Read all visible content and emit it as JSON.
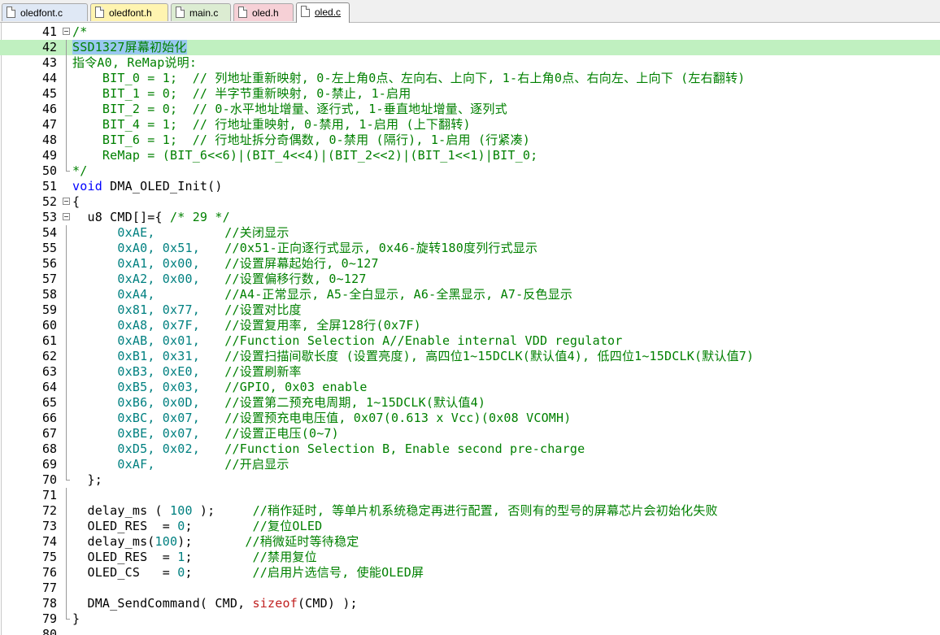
{
  "tabs": [
    {
      "label": "oledfont.c",
      "color": "#dfe8f5",
      "active": false
    },
    {
      "label": "oledfont.h",
      "color": "#fff4b0",
      "active": false
    },
    {
      "label": "main.c",
      "color": "#dcecd2",
      "active": false
    },
    {
      "label": "oled.h",
      "color": "#f6d0d6",
      "active": false
    },
    {
      "label": "oled.c",
      "color": "#ffffff",
      "active": true
    }
  ],
  "editor": {
    "lines": [
      {
        "num": "41",
        "text": "/*",
        "kind": "comment"
      },
      {
        "num": "42",
        "text": "SSD1327屏幕初始化",
        "kind": "comment-selected"
      },
      {
        "num": "43",
        "text": "指令A0, ReMap说明:",
        "kind": "comment"
      },
      {
        "num": "44",
        "text": "    BIT_0 = 1;  // 列地址重新映射, 0-左上角0点、左向右、上向下, 1-右上角0点、右向左、上向下 (左右翻转)",
        "kind": "comment"
      },
      {
        "num": "45",
        "text": "    BIT_1 = 0;  // 半字节重新映射, 0-禁止, 1-启用",
        "kind": "comment"
      },
      {
        "num": "46",
        "text": "    BIT_2 = 0;  // 0-水平地址增量、逐行式, 1-垂直地址增量、逐列式",
        "kind": "comment"
      },
      {
        "num": "47",
        "text": "    BIT_4 = 1;  // 行地址重映射, 0-禁用, 1-启用 (上下翻转)",
        "kind": "comment"
      },
      {
        "num": "48",
        "text": "    BIT_6 = 1;  // 行地址拆分奇偶数, 0-禁用 (隔行), 1-启用 (行紧凑)",
        "kind": "comment"
      },
      {
        "num": "49",
        "text": "    ReMap = (BIT_6<<6)|(BIT_4<<4)|(BIT_2<<2)|(BIT_1<<1)|BIT_0;",
        "kind": "comment"
      },
      {
        "num": "50",
        "text": "*/",
        "kind": "comment"
      },
      {
        "num": "51",
        "text_kw": "void",
        "text_rest": " DMA_OLED_Init()",
        "kind": "funcdecl"
      },
      {
        "num": "52",
        "text": "{",
        "kind": "plain"
      },
      {
        "num": "53",
        "text_plain": "  u8 CMD[]={ ",
        "text_comment": "/* 29 */",
        "kind": "arraydecl"
      },
      {
        "num": "54",
        "hex1": "0xAE,",
        "hex2": "",
        "comment": "//关闭显示",
        "kind": "cmd"
      },
      {
        "num": "55",
        "hex1": "0xA0,",
        "hex2": "0x51,",
        "comment": "//0x51-正向逐行式显示, 0x46-旋转180度列行式显示",
        "kind": "cmd"
      },
      {
        "num": "56",
        "hex1": "0xA1,",
        "hex2": "0x00,",
        "comment": "//设置屏幕起始行, 0~127",
        "kind": "cmd"
      },
      {
        "num": "57",
        "hex1": "0xA2,",
        "hex2": "0x00,",
        "comment": "//设置偏移行数, 0~127",
        "kind": "cmd"
      },
      {
        "num": "58",
        "hex1": "0xA4,",
        "hex2": "",
        "comment": "//A4-正常显示, A5-全白显示, A6-全黑显示, A7-反色显示",
        "kind": "cmd"
      },
      {
        "num": "59",
        "hex1": "0x81,",
        "hex2": "0x77,",
        "comment": "//设置对比度",
        "kind": "cmd"
      },
      {
        "num": "60",
        "hex1": "0xA8,",
        "hex2": "0x7F,",
        "comment": "//设置复用率, 全屏128行(0x7F)",
        "kind": "cmd"
      },
      {
        "num": "61",
        "hex1": "0xAB,",
        "hex2": "0x01,",
        "comment": "//Function Selection A//Enable internal VDD regulator",
        "kind": "cmd"
      },
      {
        "num": "62",
        "hex1": "0xB1,",
        "hex2": "0x31,",
        "comment": "//设置扫描间歇长度 (设置亮度), 高四位1~15DCLK(默认值4), 低四位1~15DCLK(默认值7)",
        "kind": "cmd"
      },
      {
        "num": "63",
        "hex1": "0xB3,",
        "hex2": "0xE0,",
        "comment": "//设置刷新率",
        "kind": "cmd"
      },
      {
        "num": "64",
        "hex1": "0xB5,",
        "hex2": "0x03,",
        "comment": "//GPIO, 0x03 enable",
        "kind": "cmd"
      },
      {
        "num": "65",
        "hex1": "0xB6,",
        "hex2": "0x0D,",
        "comment": "//设置第二预充电周期, 1~15DCLK(默认值4)",
        "kind": "cmd"
      },
      {
        "num": "66",
        "hex1": "0xBC,",
        "hex2": "0x07,",
        "comment": "//设置预充电电压值, 0x07(0.613 x Vcc)(0x08 VCOMH)",
        "kind": "cmd"
      },
      {
        "num": "67",
        "hex1": "0xBE,",
        "hex2": "0x07,",
        "comment": "//设置正电压(0~7)",
        "kind": "cmd"
      },
      {
        "num": "68",
        "hex1": "0xD5,",
        "hex2": "0x02,",
        "comment": "//Function Selection B, Enable second pre-charge",
        "kind": "cmd"
      },
      {
        "num": "69",
        "hex1": "0xAF,",
        "hex2": "",
        "comment": "//开启显示",
        "kind": "cmd"
      },
      {
        "num": "70",
        "text": "  };",
        "kind": "plain"
      },
      {
        "num": "71",
        "text": "",
        "kind": "plain"
      },
      {
        "num": "72",
        "code_a": "  delay_ms ( ",
        "num_val": "100",
        "code_b": " );     ",
        "comment": "//稍作延时, 等单片机系统稳定再进行配置, 否则有的型号的屏幕芯片会初始化失败",
        "kind": "call"
      },
      {
        "num": "73",
        "code_a": "  OLED_RES  = ",
        "num_val": "0",
        "code_b": ";        ",
        "comment": "//复位OLED",
        "kind": "call"
      },
      {
        "num": "74",
        "code_a": "  delay_ms(",
        "num_val": "100",
        "code_b": ");       ",
        "comment": "//稍微延时等待稳定",
        "kind": "call"
      },
      {
        "num": "75",
        "code_a": "  OLED_RES  = ",
        "num_val": "1",
        "code_b": ";        ",
        "comment": "//禁用复位",
        "kind": "call"
      },
      {
        "num": "76",
        "code_a": "  OLED_CS   = ",
        "num_val": "0",
        "code_b": ";        ",
        "comment": "//启用片选信号, 使能OLED屏",
        "kind": "call"
      },
      {
        "num": "77",
        "text": "",
        "kind": "plain"
      },
      {
        "num": "78",
        "code_a": "  DMA_SendCommand( CMD, ",
        "sizeof": "sizeof",
        "code_b": "(CMD) );",
        "kind": "sendcmd"
      },
      {
        "num": "79",
        "text": "}",
        "kind": "plain"
      },
      {
        "num": "80",
        "text": "",
        "kind": "plain"
      }
    ]
  }
}
